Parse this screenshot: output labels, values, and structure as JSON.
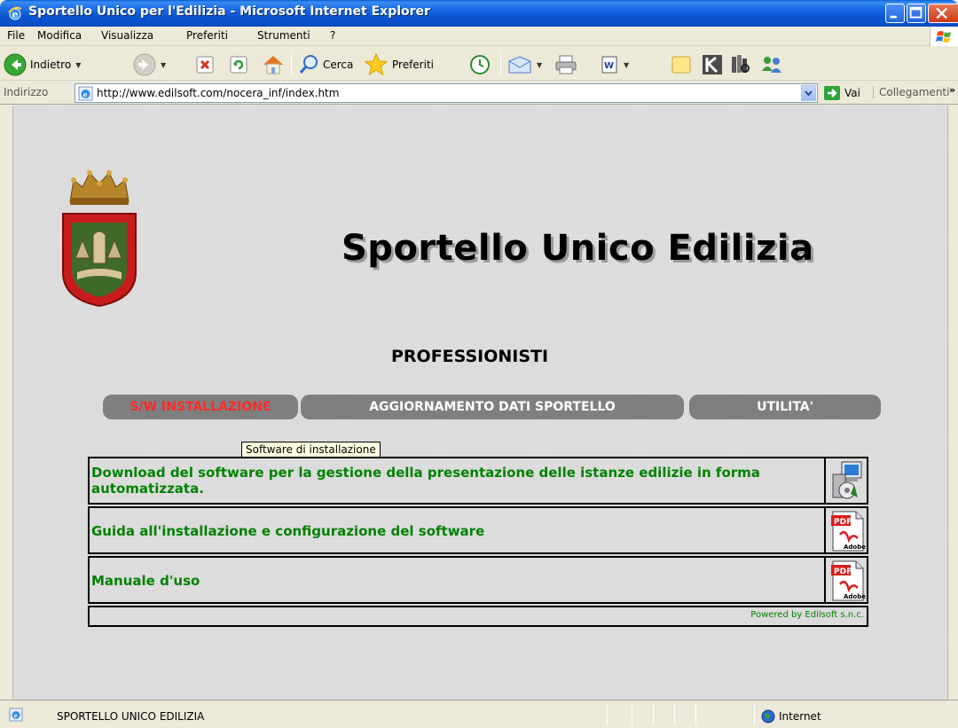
{
  "window": {
    "title": "Sportello Unico per l'Edilizia - Microsoft Internet Explorer"
  },
  "menu": [
    "File",
    "Modifica",
    "Visualizza",
    "Preferiti",
    "Strumenti",
    "?"
  ],
  "toolbar": {
    "back_label": "Indietro",
    "search_label": "Cerca",
    "favorites_label": "Preferiti"
  },
  "address": {
    "label": "Indirizzo",
    "url": "http://www.edilsoft.com/nocera_inf/index.htm",
    "go_label": "Vai",
    "links_label": "Collegamenti"
  },
  "page": {
    "title": "Sportello Unico Edilizia",
    "subtitle": "PROFESSIONISTI",
    "nav": [
      {
        "label": "S/W INSTALLAZIONE",
        "active": true
      },
      {
        "label": "AGGIORNAMENTO DATI SPORTELLO",
        "active": false
      },
      {
        "label": "UTILITA'",
        "active": false
      }
    ],
    "tooltip": "Software di installazione",
    "rows": [
      {
        "text": "Download del software per la gestione della presentazione delle istanze edilizie in forma automatizzata.",
        "icon": "software-install-icon"
      },
      {
        "text": "Guida all'installazione e configurazione del software",
        "icon": "pdf-icon"
      },
      {
        "text": "Manuale d'uso",
        "icon": "pdf-icon"
      }
    ],
    "footer": "Powered by Edilsoft s.n.c."
  },
  "status": {
    "text": "SPORTELLO UNICO EDILIZIA",
    "zone": "Internet"
  },
  "colors": {
    "link_green": "#008000",
    "active_nav": "#ff2a2a",
    "nav_bg": "#7f7f7f"
  }
}
